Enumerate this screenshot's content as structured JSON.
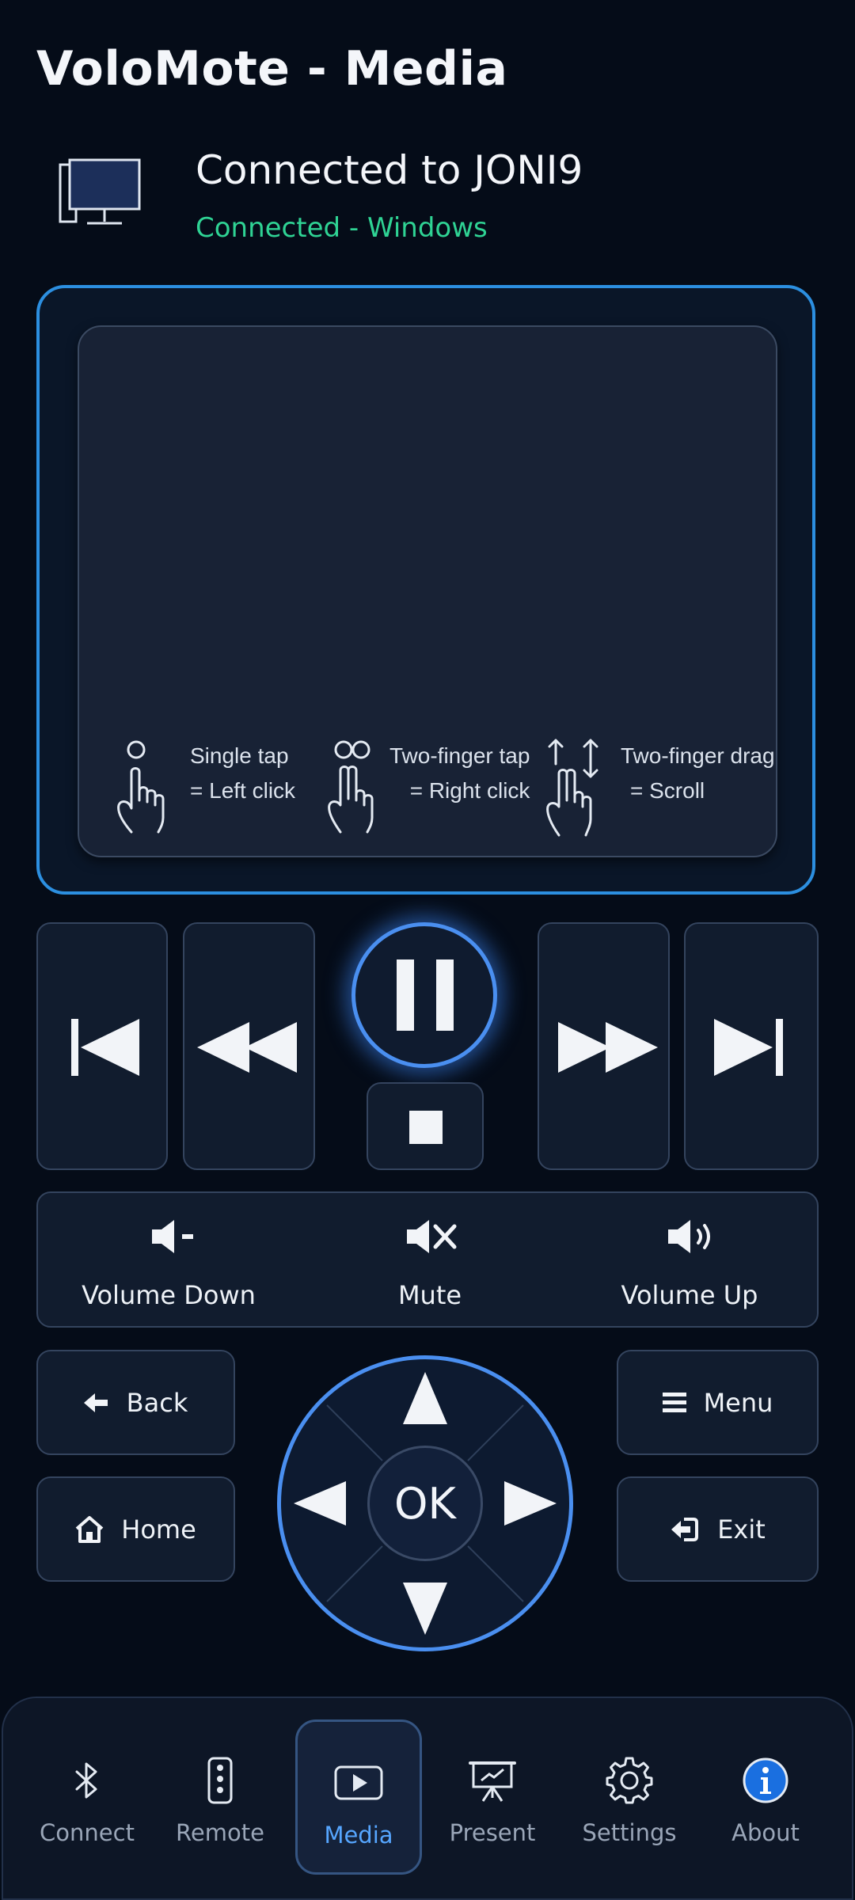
{
  "app": {
    "title": "VoloMote - Media"
  },
  "connection": {
    "title": "Connected to JONI9",
    "status": "Connected - Windows",
    "status_color": "#2fd394"
  },
  "touchpad": {
    "hints": [
      {
        "gesture": "Single tap",
        "action": "= Left click"
      },
      {
        "gesture": "Two-finger tap",
        "action": "= Right click"
      },
      {
        "gesture": "Two-finger drag",
        "action": "= Scroll"
      }
    ]
  },
  "media": {
    "icons": [
      "skip-previous-icon",
      "rewind-icon",
      "pause-icon",
      "stop-icon",
      "fast-forward-icon",
      "skip-next-icon"
    ]
  },
  "volume": {
    "down": "Volume Down",
    "mute": "Mute",
    "up": "Volume Up"
  },
  "navigation": {
    "back": "Back",
    "home": "Home",
    "menu": "Menu",
    "exit": "Exit",
    "ok": "OK"
  },
  "bottom_nav": {
    "items": [
      {
        "label": "Connect",
        "icon": "bluetooth-icon"
      },
      {
        "label": "Remote",
        "icon": "remote-icon"
      },
      {
        "label": "Media",
        "icon": "play-icon",
        "active": true
      },
      {
        "label": "Present",
        "icon": "presentation-icon"
      },
      {
        "label": "Settings",
        "icon": "gear-icon"
      },
      {
        "label": "About",
        "icon": "info-icon"
      }
    ]
  },
  "colors": {
    "accent": "#4a8ff0",
    "background": "#050c18",
    "active_label": "#56a6ff"
  }
}
